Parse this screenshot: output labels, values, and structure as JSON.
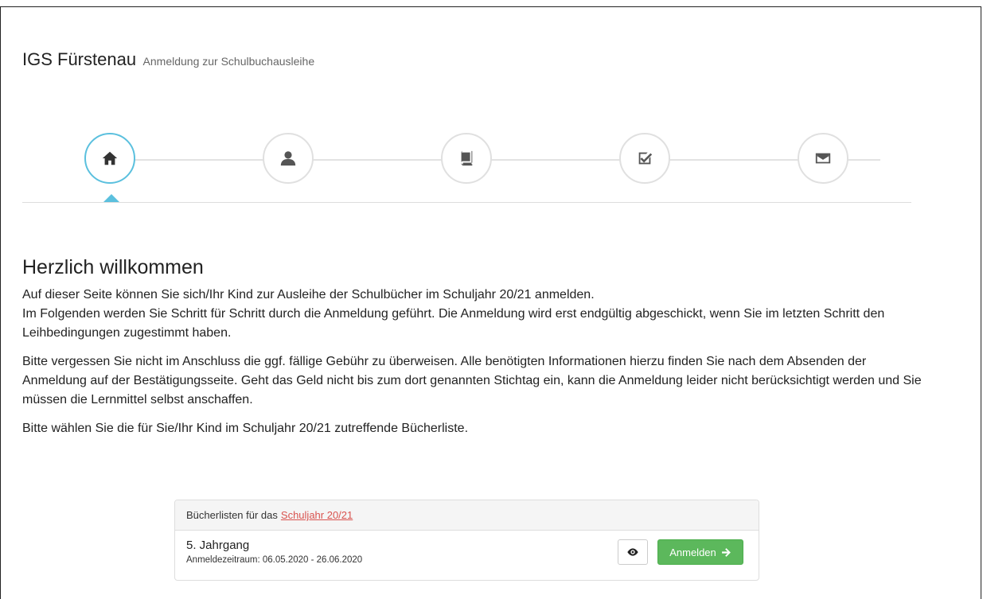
{
  "header": {
    "brand": "IGS Fürstenau",
    "subtitle": "Anmeldung zur Schulbuchausleihe"
  },
  "wizard": {
    "steps": [
      {
        "icon": "home-icon",
        "active": true
      },
      {
        "icon": "user-icon",
        "active": false
      },
      {
        "icon": "book-icon",
        "active": false
      },
      {
        "icon": "check-square-icon",
        "active": false
      },
      {
        "icon": "envelope-icon",
        "active": false
      }
    ],
    "accent_color": "#5bc0de"
  },
  "main": {
    "title": "Herzlich willkommen",
    "paragraph1_line1": "Auf dieser Seite können Sie sich/Ihr Kind zur Ausleihe der Schulbücher im Schuljahr 20/21 anmelden.",
    "paragraph1_line2": "Im Folgenden werden Sie Schritt für Schritt durch die Anmeldung geführt. Die Anmeldung wird erst endgültig abgeschickt, wenn Sie im letzten Schritt den Leihbedingungen zugestimmt haben.",
    "paragraph2": "Bitte vergessen Sie nicht im Anschluss die ggf. fällige Gebühr zu überweisen. Alle benötigten Informationen hierzu finden Sie nach dem Absenden der Anmeldung auf der Bestätigungsseite. Geht das Geld nicht bis zum dort genannten Stichtag ein, kann die Anmeldung leider nicht berücksichtigt werden und Sie müssen die Lernmittel selbst anschaffen.",
    "paragraph3": "Bitte wählen Sie die für Sie/Ihr Kind im Schuljahr 20/21 zutreffende Bücherliste."
  },
  "booklists": {
    "heading_prefix": "Bücherlisten für das",
    "heading_link": "Schuljahr 20/21",
    "items": [
      {
        "title": "5. Jahrgang",
        "period": "Anmeldezeitraum: 06.05.2020 - 26.06.2020",
        "register_label": "Anmelden"
      }
    ],
    "button_color": "#5cb85c",
    "link_color": "#d9534f"
  }
}
